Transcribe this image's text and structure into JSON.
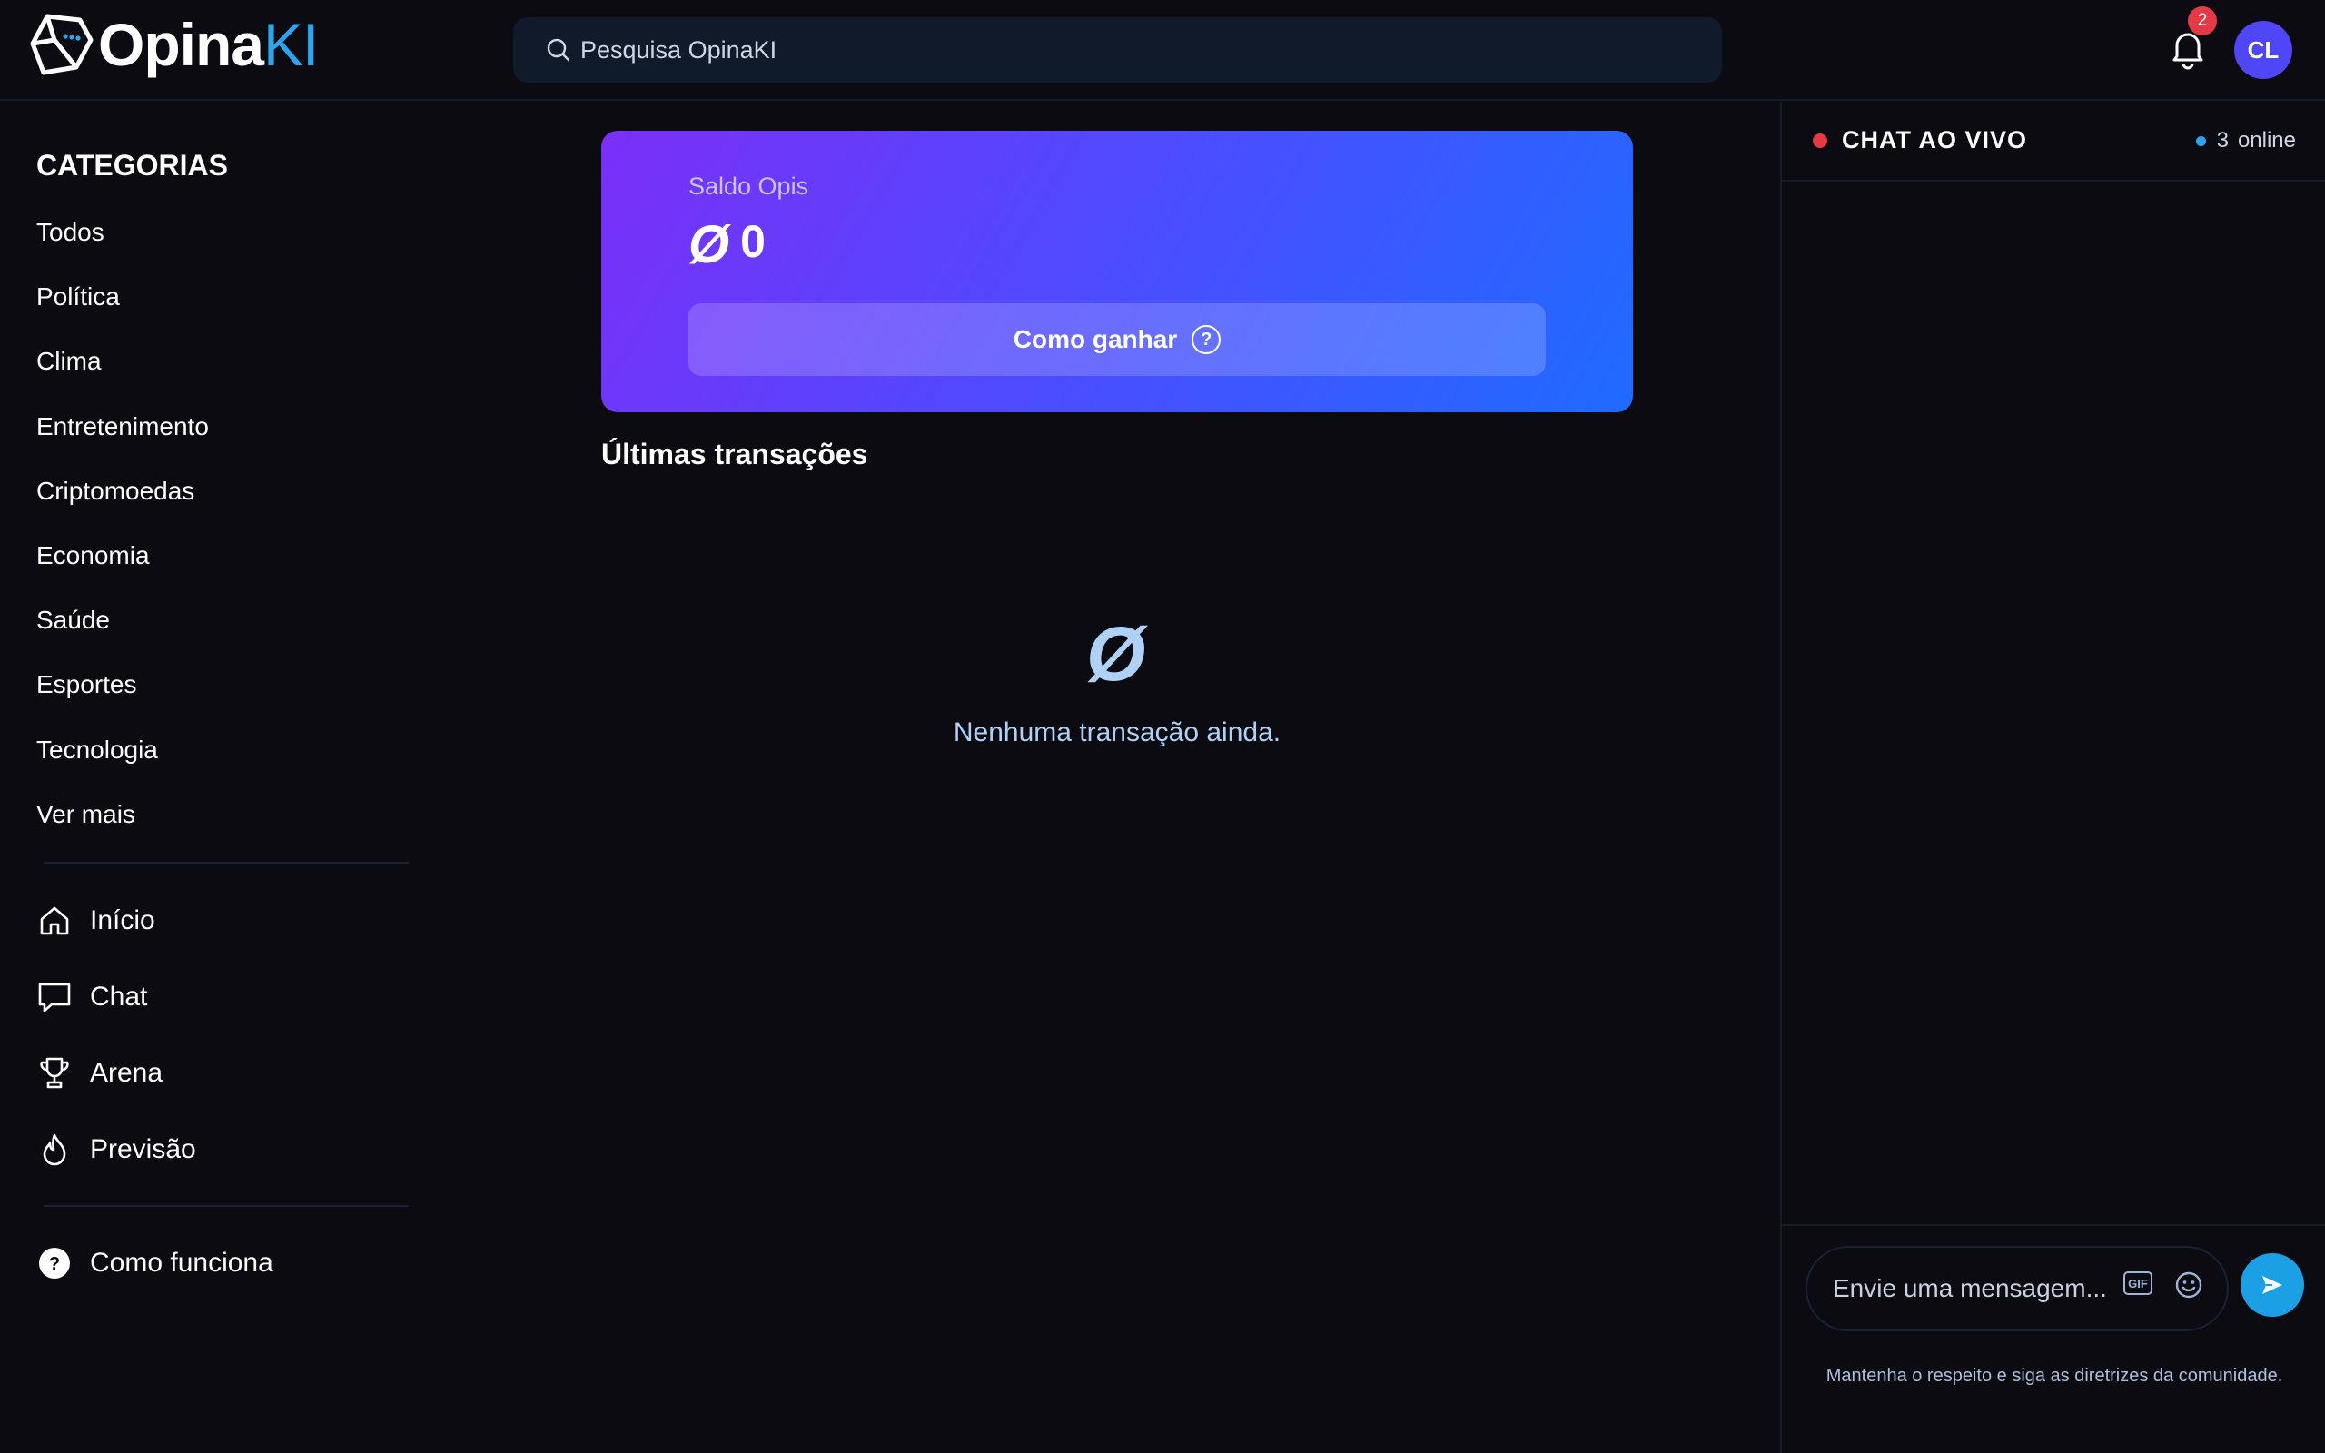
{
  "brand": {
    "name_white": "Opina",
    "name_blue": "KI"
  },
  "header": {
    "search_placeholder": "Pesquisa OpinaKI",
    "notification_count": "2",
    "avatar_initials": "CL"
  },
  "sidebar": {
    "categories_title": "CATEGORIAS",
    "categories": [
      "Todos",
      "Política",
      "Clima",
      "Entretenimento",
      "Criptomoedas",
      "Economia",
      "Saúde",
      "Esportes",
      "Tecnologia",
      "Ver mais"
    ],
    "nav": [
      {
        "label": "Início",
        "icon": "home-icon"
      },
      {
        "label": "Chat",
        "icon": "chat-bubble-icon"
      },
      {
        "label": "Arena",
        "icon": "trophy-icon"
      },
      {
        "label": "Previsão",
        "icon": "flame-icon"
      }
    ],
    "help": {
      "label": "Como funciona",
      "icon": "question-circle-icon"
    }
  },
  "main": {
    "balance_label": "Saldo Opis",
    "currency_symbol": "Ø",
    "balance_value": "0",
    "earn_button": "Como ganhar",
    "transactions_title": "Últimas transações",
    "empty_symbol": "Ø",
    "empty_text": "Nenhuma transação ainda."
  },
  "chat": {
    "title": "CHAT AO VIVO",
    "online_count": "3",
    "online_label": "online",
    "input_placeholder": "Envie uma mensagem...",
    "gif_label": "GIF",
    "guidelines": "Mantenha o respeito e siga as diretrizes da comunidade."
  },
  "colors": {
    "background": "#0b0b11",
    "accent_blue": "#1ba0e6",
    "live_red": "#e53945",
    "avatar_purple": "#4f46f5",
    "card_gradient_start": "#7b2ff7",
    "card_gradient_end": "#1f6bff"
  }
}
